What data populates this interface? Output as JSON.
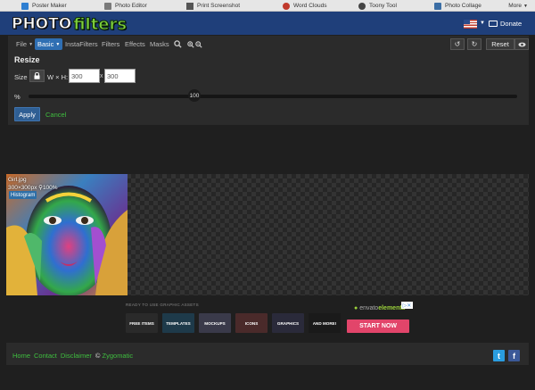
{
  "topbar": {
    "links": [
      {
        "label": "Poster Maker",
        "icon": "poster-icon",
        "color": "#2f7fd1"
      },
      {
        "label": "Photo Editor",
        "icon": "photo-editor-icon",
        "color": "#7a7a7a"
      },
      {
        "label": "Print Screenshot",
        "icon": "printer-icon",
        "color": "#555555"
      },
      {
        "label": "Word Clouds",
        "icon": "word-cloud-icon",
        "color": "#c0392b"
      },
      {
        "label": "Toony Tool",
        "icon": "toony-icon",
        "color": "#444444"
      },
      {
        "label": "Photo Collage",
        "icon": "collage-icon",
        "color": "#3b6ea5"
      }
    ],
    "more": "More"
  },
  "header": {
    "logo_part1": "PHOTO",
    "logo_part2": "filters",
    "donate": "Donate"
  },
  "menubar": {
    "items": [
      "File",
      "Basic",
      "InstaFilters",
      "Filters",
      "Effects",
      "Masks"
    ],
    "active": "Basic",
    "reset": "Reset"
  },
  "resize": {
    "title": "Resize",
    "size_label": "Size",
    "wh_label": "W × H:",
    "width": "300",
    "height": "300",
    "sep": "x",
    "percent_label": "%",
    "percent_value": "100",
    "apply": "Apply",
    "cancel": "Cancel"
  },
  "image": {
    "filename": "Girl.jpg",
    "dimensions": "300×300px",
    "zoom": "100%",
    "histogram": "Histogram"
  },
  "ad": {
    "headline": "READY TO USE GRAPHIC ASSETS",
    "brand_pre": "envato",
    "brand": "elements",
    "tiles": [
      "FREE ITEMS",
      "TEMPLATES",
      "MOCKUPS",
      "ICONS",
      "GRAPHICS",
      "AND MORE!"
    ],
    "cta": "START NOW"
  },
  "footer": {
    "links": [
      "Home",
      "Contact",
      "Disclaimer"
    ],
    "copyright_symbol": "©",
    "copyright_name": "Zygomatic"
  },
  "colors": {
    "header_bg": "#1f3f7a",
    "accent_link": "#3fbf3f",
    "active_tab": "#2f6fb3",
    "apply_btn": "#2f5f94",
    "ad_cta": "#e2456a"
  }
}
